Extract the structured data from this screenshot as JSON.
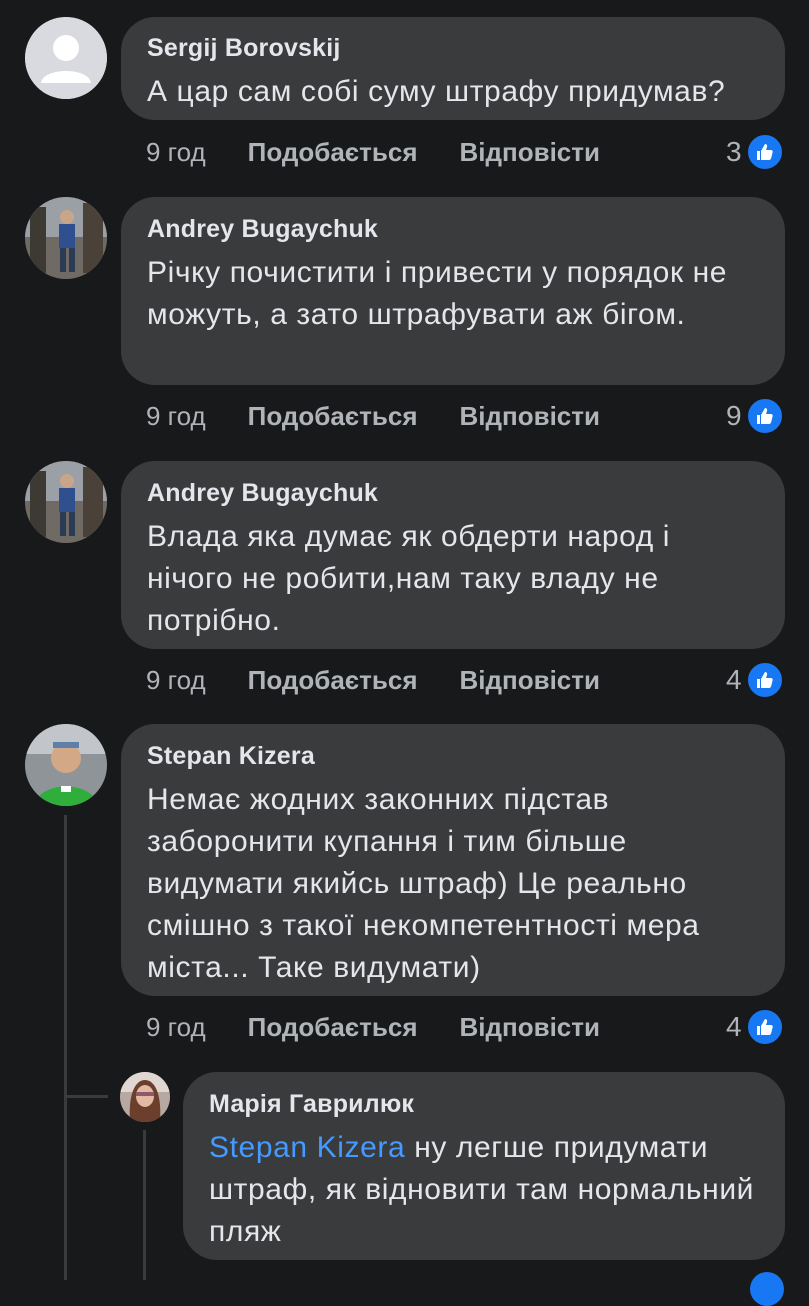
{
  "comments": [
    {
      "author": "Sergij Borovskij",
      "text": "А цар сам собі суму штрафу придумав?",
      "time": "9 год",
      "like_label": "Подобається",
      "reply_label": "Відповісти",
      "likes": "3"
    },
    {
      "author": "Andrey  Bugaychuk",
      "text": "Річку почистити і привести у порядок не можуть, а зато штрафувати аж бігом.",
      "time": "9 год",
      "like_label": "Подобається",
      "reply_label": "Відповісти",
      "likes": "9"
    },
    {
      "author": "Andrey  Bugaychuk",
      "text": "Влада яка думає як обдерти народ і нічого не робити,нам таку владу не потрібно.",
      "time": "9 год",
      "like_label": "Подобається",
      "reply_label": "Відповісти",
      "likes": "4"
    },
    {
      "author": "Stepan Kizera",
      "text": "Немає жодних законних підстав заборонити купання і тим більше видумати якийсь штраф) Це реально смішно з такої некомпетентності мера міста... Таке видумати)",
      "time": "9 год",
      "like_label": "Подобається",
      "reply_label": "Відповісти",
      "likes": "4"
    }
  ],
  "reply": {
    "author": "Марія Гаврилюк",
    "mention": "Stepan Kizera",
    "text": " ну легше придумати штраф, як відновити там нормальний пляж"
  },
  "icons": {
    "like": "thumbs-up-icon"
  },
  "colors": {
    "background": "#18191a",
    "bubble": "#3a3b3c",
    "mention": "#4599ff",
    "like": "#1877f2"
  }
}
